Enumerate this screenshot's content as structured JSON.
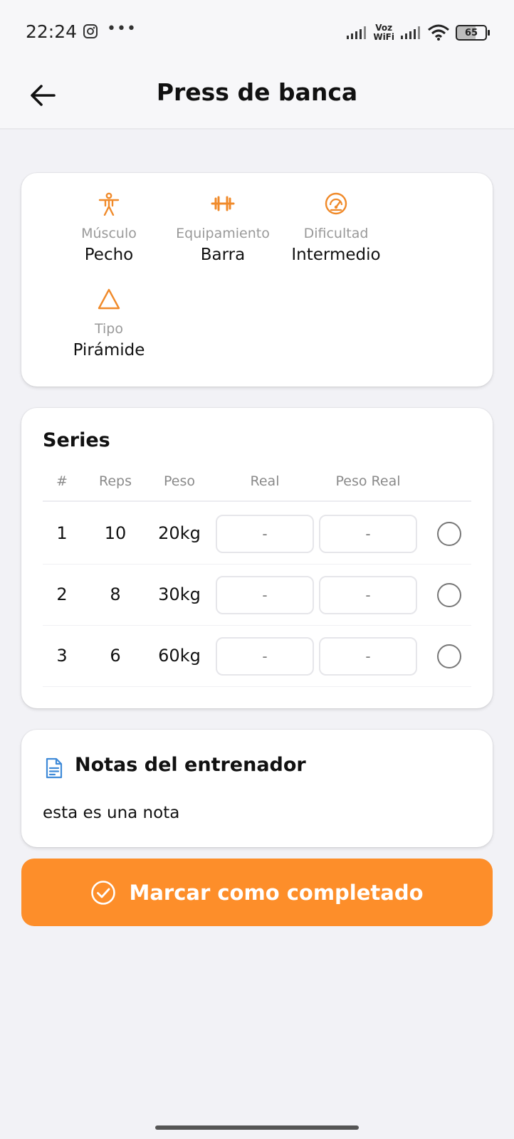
{
  "status_bar": {
    "time": "22:24",
    "notification_icons": [
      "instagram-icon",
      "more-dots"
    ],
    "dots": "•••",
    "voz_line1": "Voz",
    "voz_line2": "WiFi",
    "battery": "65"
  },
  "header": {
    "title": "Press de banca"
  },
  "info": {
    "items": [
      {
        "icon": "body-icon",
        "label": "Músculo",
        "value": "Pecho"
      },
      {
        "icon": "dumbbell-icon",
        "label": "Equipamiento",
        "value": "Barra"
      },
      {
        "icon": "gauge-icon",
        "label": "Dificultad",
        "value": "Intermedio"
      },
      {
        "icon": "triangle-icon",
        "label": "Tipo",
        "value": "Pirámide"
      }
    ]
  },
  "series": {
    "title": "Series",
    "columns": [
      "#",
      "Reps",
      "Peso",
      "Real",
      "Peso Real"
    ],
    "rows": [
      {
        "num": "1",
        "reps": "10",
        "weight": "20kg",
        "real": "-",
        "real_weight": "-"
      },
      {
        "num": "2",
        "reps": "8",
        "weight": "30kg",
        "real": "-",
        "real_weight": "-"
      },
      {
        "num": "3",
        "reps": "6",
        "weight": "60kg",
        "real": "-",
        "real_weight": "-"
      }
    ]
  },
  "notes": {
    "title": "Notas del entrenador",
    "text": "esta es una nota"
  },
  "actions": {
    "complete_label": "Marcar como completado"
  },
  "colors": {
    "accent": "#fd8e2a",
    "background": "#f2f2f6",
    "note_icon": "#3f8ad8"
  }
}
